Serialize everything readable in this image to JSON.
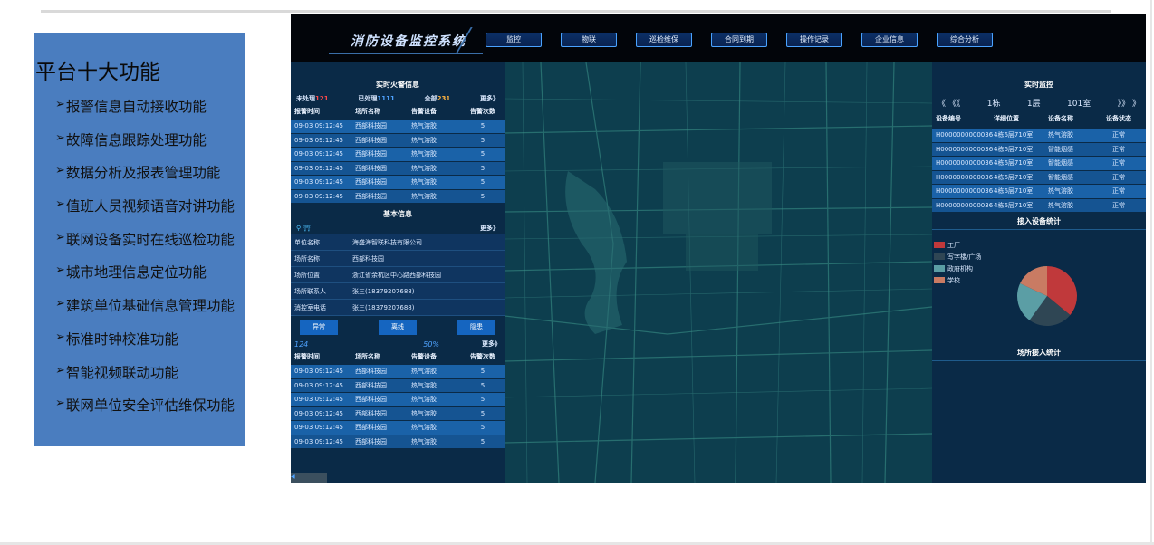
{
  "feature_panel": {
    "title": "平台十大功能",
    "arrow": "➢",
    "items": [
      "报警信息自动接收功能",
      "故障信息跟踪处理功能",
      "数据分析及报表管理功能",
      "值班人员视频语音对讲功能",
      "联网设备实时在线巡检功能",
      "城市地理信息定位功能",
      "建筑单位基础信息管理功能",
      "标准时钟校准功能",
      "智能视频联动功能",
      "联网单位安全评估维保功能"
    ]
  },
  "app": {
    "brand": "消防设备监控系统",
    "nav": [
      "监控",
      "物联",
      "巡检维保",
      "合同到期",
      "操作记录",
      "企业信息",
      "综合分析"
    ]
  },
  "fire_alarm": {
    "title": "实时火警信息",
    "unhandled_label": "未处理",
    "unhandled_count": "121",
    "handled_label": "已处理",
    "handled_count": "1111",
    "total_label": "全部",
    "total_count": "231",
    "more": "更多》",
    "columns": [
      "报警时间",
      "场所名称",
      "告警设备",
      "告警次数"
    ],
    "rows": [
      [
        "09-03 09:12:45",
        "西部科技园",
        "热气溶胶",
        "5"
      ],
      [
        "09-03 09:12:45",
        "西部科技园",
        "热气溶胶",
        "5"
      ],
      [
        "09-03 09:12:45",
        "西部科技园",
        "热气溶胶",
        "5"
      ],
      [
        "09-03 09:12:45",
        "西部科技园",
        "热气溶胶",
        "5"
      ],
      [
        "09-03 09:12:45",
        "西部科技园",
        "热气溶胶",
        "5"
      ],
      [
        "09-03 09:12:45",
        "西部科技园",
        "热气溶胶",
        "5"
      ]
    ]
  },
  "basic_info": {
    "title": "基本信息",
    "more": "更多》",
    "fields": [
      {
        "label": "单位名称",
        "value": "海盛海智联科技有限公司"
      },
      {
        "label": "场所名称",
        "value": "西部科技园"
      },
      {
        "label": "场所位置",
        "value": "浙江省余杭区中心路西部科技园"
      },
      {
        "label": "场所联系人",
        "value": "张三(18379207688)"
      },
      {
        "label": "消控室电话",
        "value": "张三(18379207688)"
      }
    ],
    "buttons": [
      "异常",
      "离线",
      "隐患"
    ],
    "count": "124",
    "percent": "50%",
    "more2": "更多》",
    "columns": [
      "报警时间",
      "场所名称",
      "告警设备",
      "告警次数"
    ],
    "rows": [
      [
        "09-03 09:12:45",
        "西部科技园",
        "热气溶胶",
        "5"
      ],
      [
        "09-03 09:12:45",
        "西部科技园",
        "热气溶胶",
        "5"
      ],
      [
        "09-03 09:12:45",
        "西部科技园",
        "热气溶胶",
        "5"
      ],
      [
        "09-03 09:12:45",
        "西部科技园",
        "热气溶胶",
        "5"
      ],
      [
        "09-03 09:12:45",
        "西部科技园",
        "热气溶胶",
        "5"
      ],
      [
        "09-03 09:12:45",
        "西部科技园",
        "热气溶胶",
        "5"
      ]
    ]
  },
  "monitor": {
    "title": "实时监控",
    "prev": "《 《《",
    "building": "1栋",
    "floor": "1层",
    "room": "101室",
    "next": "》》 》",
    "columns": [
      "设备编号",
      "详细位置",
      "设备名称",
      "设备状态"
    ],
    "rows": [
      [
        "H0000000000036",
        "4栋6层710室",
        "热气溶胶",
        "正常"
      ],
      [
        "H0000000000036",
        "4栋6层710室",
        "智能烟感",
        "正常"
      ],
      [
        "H0000000000036",
        "4栋6层710室",
        "智能烟感",
        "正常"
      ],
      [
        "H0000000000036",
        "4栋6层710室",
        "智能烟感",
        "正常"
      ],
      [
        "H0000000000036",
        "4栋6层710室",
        "热气溶胶",
        "正常"
      ],
      [
        "H0000000000036",
        "4栋6层710室",
        "热气溶胶",
        "正常"
      ]
    ]
  },
  "device_stats": {
    "title": "接入设备统计",
    "legend": [
      {
        "label": "工厂",
        "color": "#c0393b"
      },
      {
        "label": "写字楼/广场",
        "color": "#2f4654"
      },
      {
        "label": "政府机构",
        "color": "#5b9ea5"
      },
      {
        "label": "学校",
        "color": "#c97b63"
      }
    ],
    "slices": [
      0.36,
      0.24,
      0.22,
      0.18
    ]
  },
  "venue_stats": {
    "title": "场所接入统计"
  }
}
